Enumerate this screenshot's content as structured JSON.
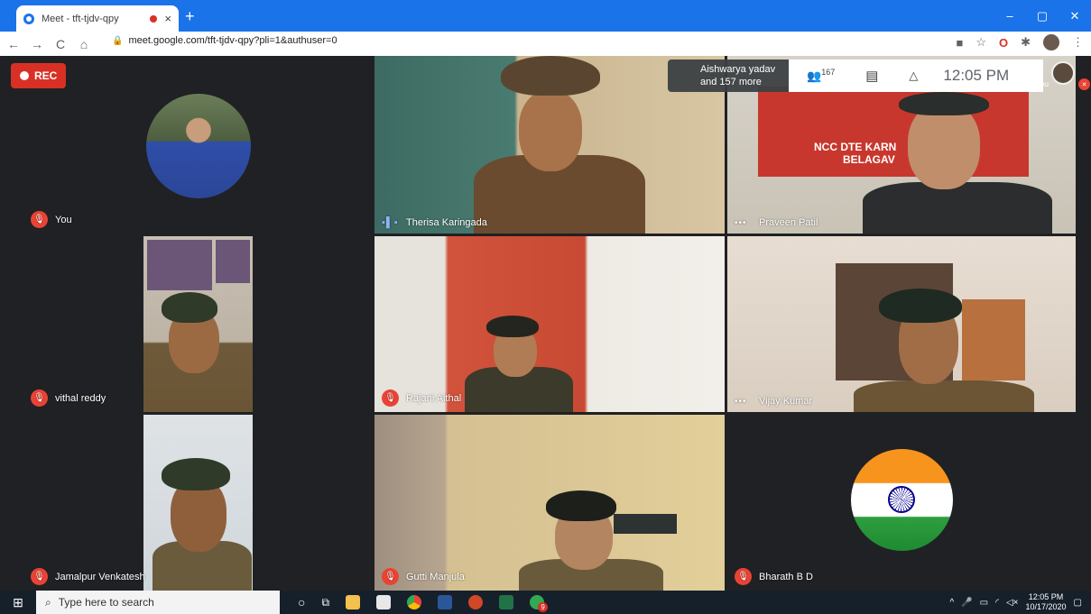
{
  "browser": {
    "tab_title": "Meet - tft-tjdv-qpy",
    "tab_close": "×",
    "new_tab": "+",
    "url": "meet.google.com/tft-tjdv-qpy?pli=1&authuser=0",
    "win_min": "–",
    "win_max": "▢",
    "win_close": "✕",
    "nav_back": "←",
    "nav_forward": "→",
    "nav_reload": "C",
    "nav_home": "⌂",
    "ext_o": "O",
    "bookmark_star": "☆",
    "menu_dots": "⋮"
  },
  "meet": {
    "rec_label": "REC",
    "notification_line1": "Aishwarya yadav",
    "notification_line2": "and 157 more",
    "participant_count": "167",
    "time": "12:05 PM",
    "you_label": "You",
    "participants": [
      {
        "name": "You",
        "status": "muted"
      },
      {
        "name": "Therisa Karingada",
        "status": "speaking"
      },
      {
        "name": "Praveen Patil",
        "status": "dots"
      },
      {
        "name": "vithal reddy",
        "status": "muted"
      },
      {
        "name": "Rajani Aithal",
        "status": "muted"
      },
      {
        "name": "Vijay Kumar",
        "status": "dots"
      },
      {
        "name": "Jamalpur Venkatesh",
        "status": "muted"
      },
      {
        "name": "Gutti Manjula",
        "status": "muted"
      },
      {
        "name": "Bharath B D",
        "status": "muted"
      }
    ],
    "banner_line1": "NCC DTE KARN",
    "banner_line2": "BELAGAV"
  },
  "taskbar": {
    "search_placeholder": "Type here to search",
    "clock_time": "12:05 PM",
    "clock_date": "10/17/2020",
    "chrome_badge": "9"
  },
  "colors": {
    "brand_blue": "#1a73e8",
    "rec_red": "#d93025",
    "mic_red": "#ea4335",
    "stage_bg": "#202124"
  }
}
